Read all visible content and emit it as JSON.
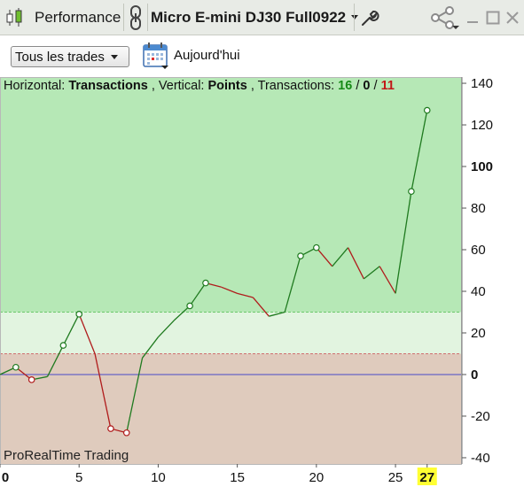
{
  "window": {
    "tab_title": "Performance",
    "instrument": "Micro E-mini DJ30 Full0922"
  },
  "toolbar": {
    "filter_value": "Tous les trades",
    "date_label": "Aujourd'hui"
  },
  "stats": {
    "horizontal_label": "Horizontal:",
    "horizontal_value": "Transactions",
    "vertical_label": ", Vertical:",
    "vertical_value": "Points",
    "transactions_label": ", Transactions:",
    "wins": "16",
    "neutral": "0",
    "losses": "11",
    "sep1": " / ",
    "sep2": " / "
  },
  "brand": "ProRealTime Trading",
  "colors": {
    "upper_zone": "#b6e8b6",
    "middle_zone": "#e2f4e0",
    "lower_zone": "#dfcbbd",
    "gain_line": "#1f7a1f",
    "loss_line": "#b01c1c",
    "zero_line": "#4a4ac8",
    "highlight_tick": "#ffff33"
  },
  "chart_data": {
    "type": "line",
    "x": [
      0,
      1,
      2,
      3,
      4,
      5,
      6,
      7,
      8,
      9,
      10,
      11,
      12,
      13,
      14,
      15,
      16,
      17,
      18,
      19,
      20,
      21,
      22,
      23,
      24,
      25,
      26,
      27
    ],
    "values": [
      0,
      3.5,
      -2.5,
      -1,
      14,
      29,
      10,
      -26,
      -28,
      8,
      18,
      26,
      33,
      44,
      42,
      39,
      37,
      28,
      30,
      57,
      61,
      52,
      61,
      46,
      52,
      39,
      88,
      127
    ],
    "markers": [
      1,
      2,
      4,
      5,
      7,
      8,
      12,
      13,
      19,
      20,
      26,
      27
    ],
    "xlim": [
      0,
      29.2
    ],
    "ylim": [
      -43,
      143
    ],
    "x_ticks": [
      0,
      5,
      10,
      15,
      20,
      25,
      27
    ],
    "x_tick_labels": [
      "0",
      "5",
      "10",
      "15",
      "20",
      "25",
      "27"
    ],
    "y_ticks": [
      140,
      120,
      100,
      80,
      60,
      40,
      20,
      0,
      -20,
      -40
    ],
    "y_tick_labels": [
      "140",
      "120",
      "100",
      "80",
      "60",
      "40",
      "20",
      "0",
      "-20",
      "-40"
    ],
    "bold_y_ticks": [
      100,
      0
    ],
    "highlight_x_tick": 27,
    "zones": {
      "upper_threshold": 30,
      "lower_threshold": 10
    },
    "grid": false
  }
}
